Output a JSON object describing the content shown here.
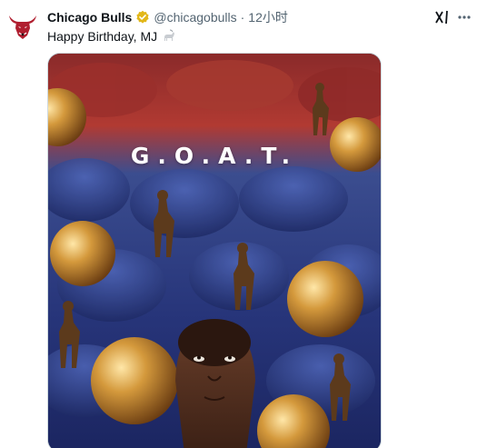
{
  "tweet": {
    "author_name": "Chicago Bulls",
    "author_handle": "@chicagobulls",
    "separator": "·",
    "time": "12小时",
    "text": "Happy Birthday, MJ",
    "image_text": "G.O.A.T."
  },
  "icons": {
    "avatar": "bulls-logo-icon",
    "verified": "verified-badge-icon",
    "emoji": "goat-emoji-icon",
    "grok": "grok-icon",
    "more": "more-options-icon"
  },
  "colors": {
    "verified_gold": "#e2b719",
    "text_primary": "#0f1419",
    "text_secondary": "#536471",
    "bulls_red": "#b01e2f"
  }
}
